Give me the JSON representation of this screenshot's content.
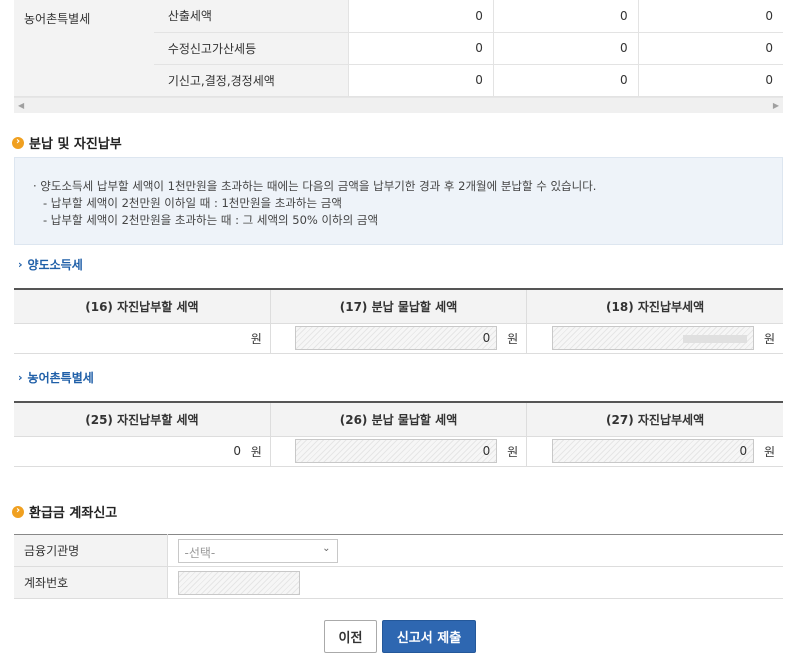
{
  "top_table": {
    "group_label": "농어촌특별세",
    "rows": [
      {
        "label": "산출세액",
        "values": [
          "0",
          "0",
          "0"
        ]
      },
      {
        "label": "수정신고가산세등",
        "values": [
          "0",
          "0",
          "0"
        ]
      },
      {
        "label": "기신고,결정,경정세액",
        "values": [
          "0",
          "0",
          "0"
        ]
      }
    ]
  },
  "installment": {
    "title": "분납 및 자진납부",
    "notice_line1": "· 양도소득세 납부할 세액이 1천만원을 초과하는 때에는 다음의 금액을 납부기한 경과 후 2개월에 분납할 수 있습니다.",
    "notice_line2": "- 납부할 세액이 2천만원 이하일 때 : 1천만원을 초과하는 금액",
    "notice_line3": "- 납부할 세액이 2천만원을 초과하는 때 : 그 세액의 50% 이하의 금액"
  },
  "cgt": {
    "title": "양도소득세",
    "headers": [
      "(16) 자진납부할 세액",
      "(17) 분납 물납할 세액",
      "(18) 자진납부세액"
    ],
    "col1_value": "",
    "col2_value": "0",
    "unit": "원"
  },
  "rural": {
    "title": "농어촌특별세",
    "headers": [
      "(25) 자진납부할 세액",
      "(26) 분납 물납할 세액",
      "(27) 자진납부세액"
    ],
    "col1_value": "0",
    "col2_value": "0",
    "col3_value": "0",
    "unit": "원"
  },
  "refund": {
    "title": "환급금 계좌신고",
    "bank_label": "금융기관명",
    "bank_select": "-선택-",
    "account_label": "계좌번호"
  },
  "buttons": {
    "prev": "이전",
    "submit": "신고서 제출"
  }
}
